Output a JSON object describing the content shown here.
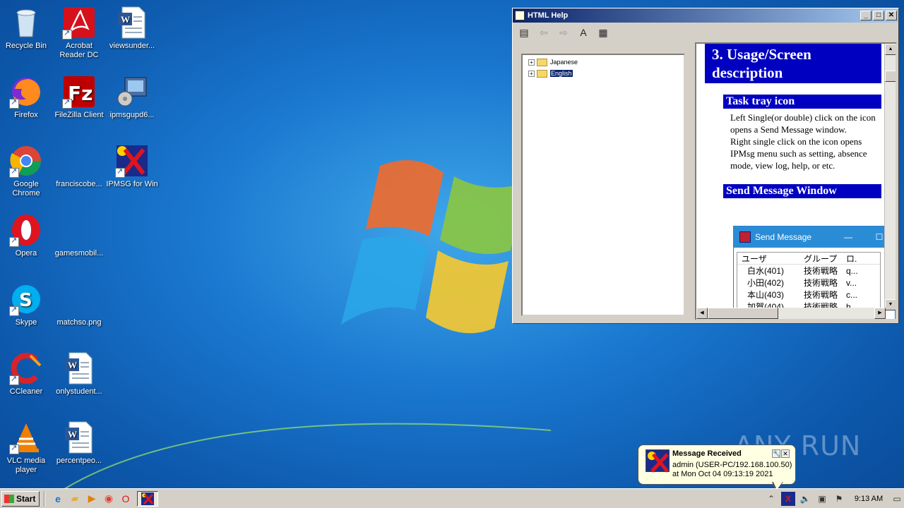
{
  "desktop": {
    "icons": [
      {
        "label": "Recycle Bin",
        "icon": "recycle-bin-icon"
      },
      {
        "label": "Acrobat Reader DC",
        "icon": "acrobat-icon"
      },
      {
        "label": "viewsunder...",
        "icon": "word-doc-icon"
      },
      {
        "label": "Firefox",
        "icon": "firefox-icon"
      },
      {
        "label": "FileZilla Client",
        "icon": "filezilla-icon"
      },
      {
        "label": "ipmsgupd6...",
        "icon": "installer-icon"
      },
      {
        "label": "Google Chrome",
        "icon": "chrome-icon"
      },
      {
        "label": "franciscobe...",
        "icon": "blank-file-icon"
      },
      {
        "label": "IPMSG for Win",
        "icon": "ipmsg-icon"
      },
      {
        "label": "Opera",
        "icon": "opera-icon"
      },
      {
        "label": "gamesmobil...",
        "icon": "blank-file-icon"
      },
      {
        "label": "Skype",
        "icon": "skype-icon"
      },
      {
        "label": "matchso.png",
        "icon": "blank-file-icon"
      },
      {
        "label": "CCleaner",
        "icon": "ccleaner-icon"
      },
      {
        "label": "onlystudent...",
        "icon": "word-doc-icon"
      },
      {
        "label": "VLC media player",
        "icon": "vlc-icon"
      },
      {
        "label": "percentpeo...",
        "icon": "word-doc-icon"
      }
    ]
  },
  "help_window": {
    "title": "HTML Help",
    "tree": [
      {
        "label": "Japanese",
        "selected": false
      },
      {
        "label": "English",
        "selected": true
      }
    ],
    "content": {
      "heading": "3. Usage/Screen description",
      "section1_title": "Task tray icon",
      "section1_line1": "Left Single(or double) click on the icon opens a Send Message window.",
      "section1_line2": "Right single click on the icon opens IPMsg menu such as setting, absence mode, view log, help, or etc.",
      "section2_title": "Send Message Window",
      "send_message": {
        "title": "Send Message",
        "columns": [
          "ユーザ",
          "グループ",
          "ロ."
        ],
        "rows": [
          [
            "白水(401)",
            "技術戦略",
            "q..."
          ],
          [
            "小田(402)",
            "技術戦略",
            "v..."
          ],
          [
            "本山(403)",
            "技術戦略",
            "c..."
          ],
          [
            "加賀(404)",
            "技術戦略",
            "h..."
          ]
        ]
      }
    }
  },
  "balloon": {
    "title": "Message Received",
    "line1": "admin (USER-PC/192.168.100.50)",
    "line2": "at Mon Oct 04 09:13:19 2021"
  },
  "watermark": "ANY RUN",
  "taskbar": {
    "start_label": "Start",
    "clock": "9:13 AM"
  }
}
